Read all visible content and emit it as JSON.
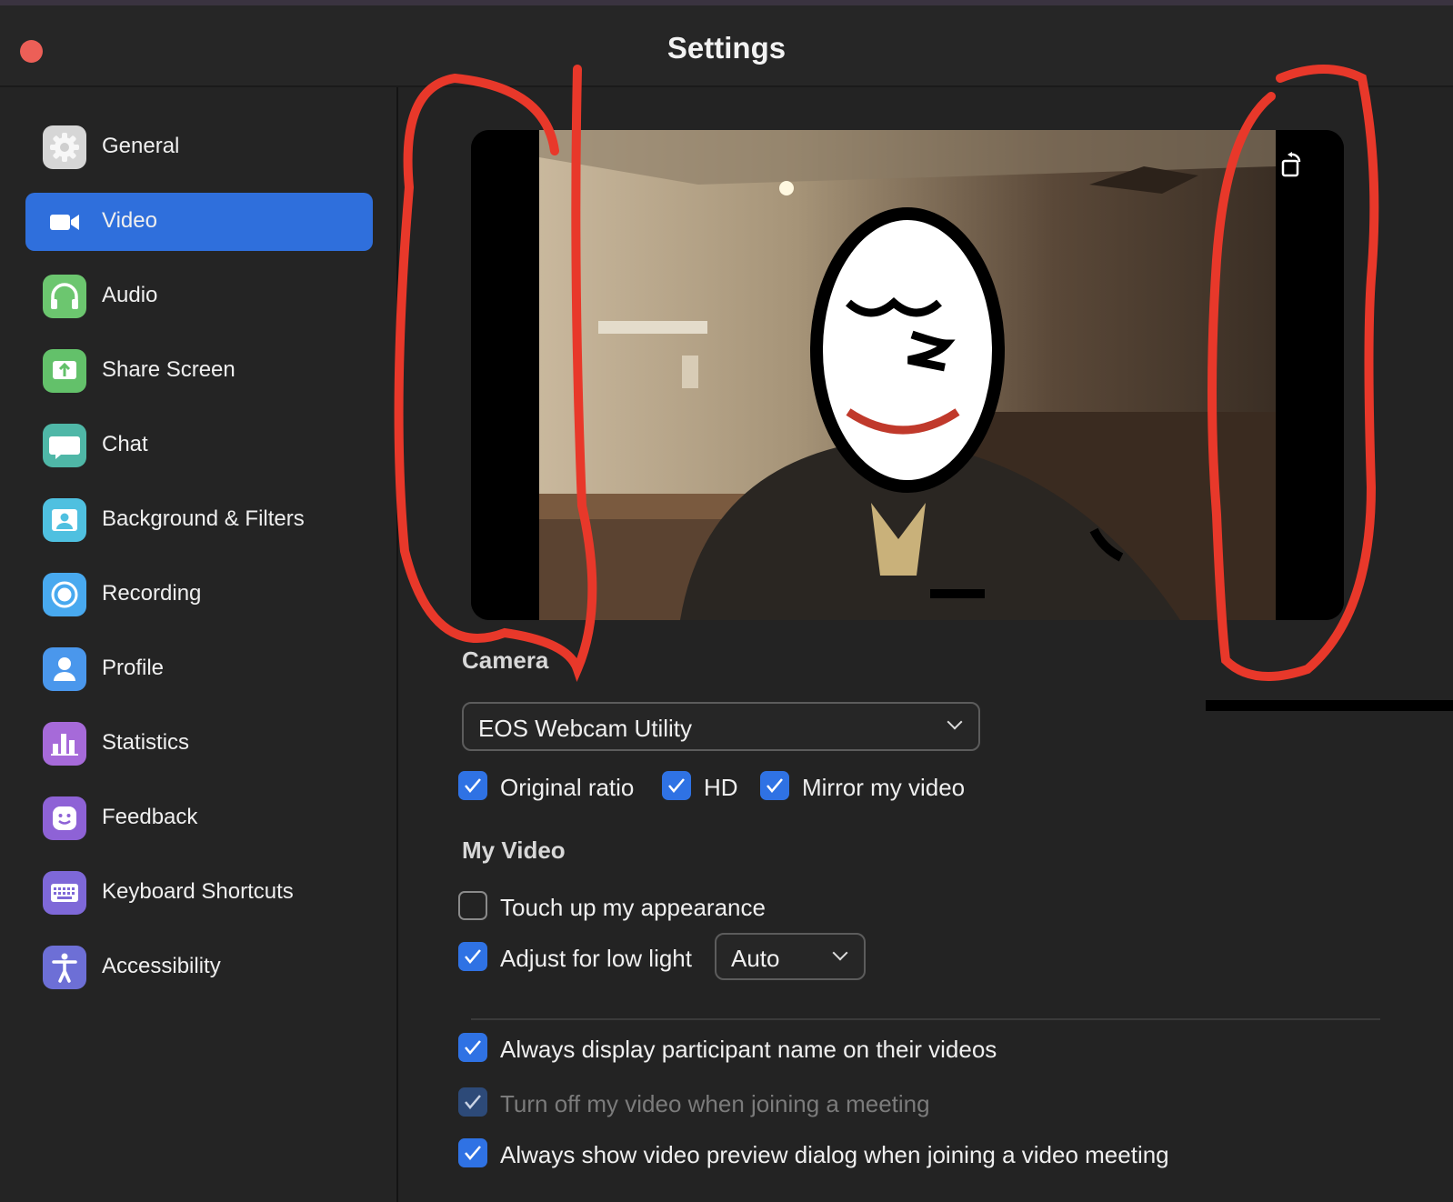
{
  "window": {
    "title": "Settings"
  },
  "sidebar": {
    "items": [
      {
        "label": "General",
        "icon": "gear-icon",
        "color": "#d9d9d9"
      },
      {
        "label": "Video",
        "icon": "video-camera-icon",
        "color": "#2f6fdc",
        "active": true
      },
      {
        "label": "Audio",
        "icon": "headphones-icon",
        "color": "#6cc66f"
      },
      {
        "label": "Share Screen",
        "icon": "share-screen-icon",
        "color": "#63c16a"
      },
      {
        "label": "Chat",
        "icon": "chat-bubble-icon",
        "color": "#4fb7a7"
      },
      {
        "label": "Background & Filters",
        "icon": "person-picture-icon",
        "color": "#4fc0e0"
      },
      {
        "label": "Recording",
        "icon": "record-icon",
        "color": "#48a9ef"
      },
      {
        "label": "Profile",
        "icon": "person-icon",
        "color": "#4a97ec"
      },
      {
        "label": "Statistics",
        "icon": "bar-chart-icon",
        "color": "#a66ad9"
      },
      {
        "label": "Feedback",
        "icon": "smiley-icon",
        "color": "#8e62d6"
      },
      {
        "label": "Keyboard Shortcuts",
        "icon": "keyboard-icon",
        "color": "#7e68d8"
      },
      {
        "label": "Accessibility",
        "icon": "accessibility-icon",
        "color": "#6d6fd6"
      }
    ]
  },
  "camera": {
    "heading": "Camera",
    "selected": "EOS Webcam Utility",
    "options": [
      {
        "label": "Original ratio",
        "checked": true
      },
      {
        "label": "HD",
        "checked": true
      },
      {
        "label": "Mirror my video",
        "checked": true
      }
    ]
  },
  "my_video": {
    "heading": "My Video",
    "touch_up": {
      "label": "Touch up my appearance",
      "checked": false
    },
    "low_light": {
      "label": "Adjust for low light",
      "checked": true,
      "mode": "Auto"
    }
  },
  "meeting_options": [
    {
      "label": "Always display participant name on their videos",
      "checked": true,
      "disabled": false
    },
    {
      "label": "Turn off my video when joining a meeting",
      "checked": true,
      "disabled": true
    },
    {
      "label": "Always show video preview dialog when joining a video meeting",
      "checked": true,
      "disabled": false
    }
  ],
  "colors": {
    "accent": "#2f72e4",
    "annotation": "#e8382a",
    "background": "#232323"
  }
}
